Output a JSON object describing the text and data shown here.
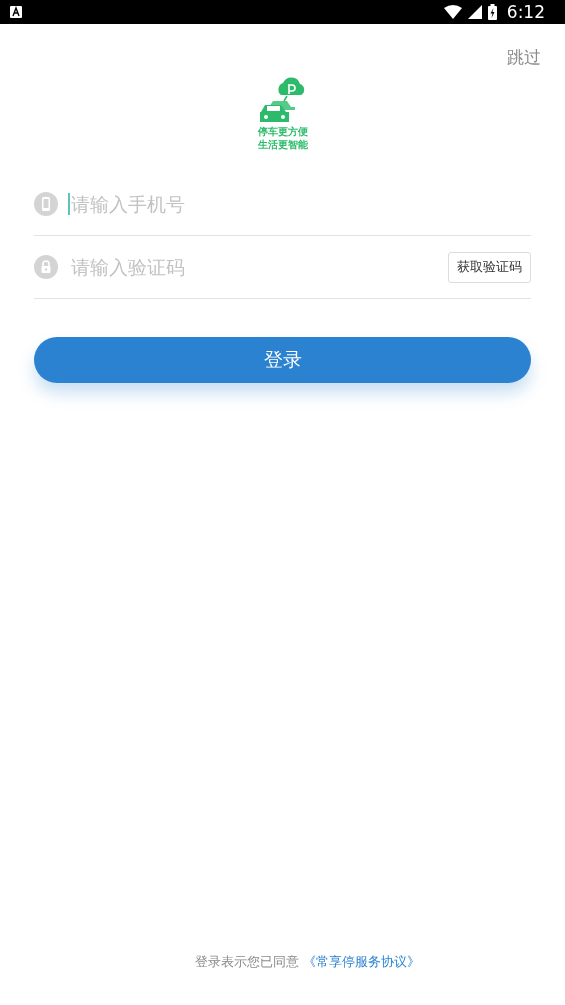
{
  "status_bar": {
    "time": "6:12"
  },
  "skip": "跳过",
  "logo": {
    "line_1": "停车更方便",
    "line_2": "生活更智能"
  },
  "fields": [
    {
      "kind": "phone",
      "placeholder": "请输入手机号",
      "focused": true
    },
    {
      "kind": "code",
      "placeholder": "请输入验证码",
      "focused": false,
      "button": "获取验证码"
    }
  ],
  "login_button": "登录",
  "agreement": {
    "text": "登录表示您已同意",
    "link": "《常享停服务协议》"
  }
}
